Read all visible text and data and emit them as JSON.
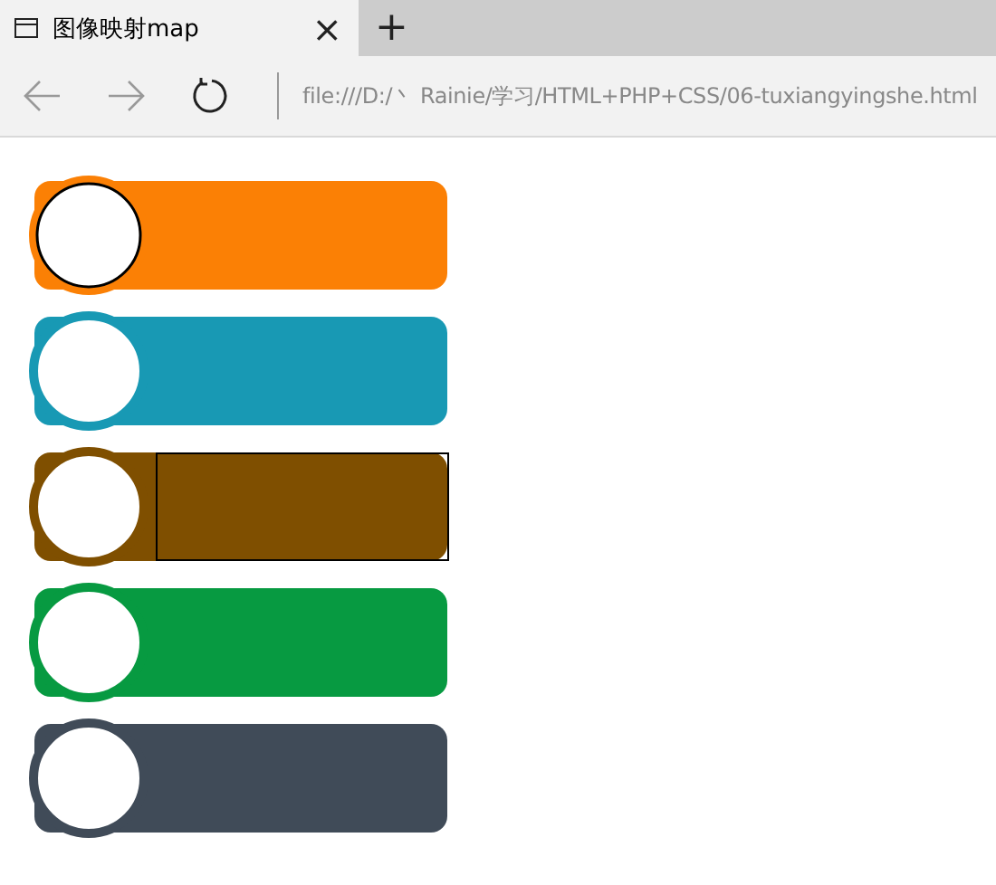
{
  "tab": {
    "title": "图像映射map",
    "close": "×",
    "new_tab": "+"
  },
  "address": {
    "url": "file:///D:/丶 Rainie/学习/HTML+PHP+CSS/06-tuxiangyingshe.html"
  },
  "areas": [
    {
      "color": "#fb8005",
      "circle_focused": true,
      "bar_focused": false
    },
    {
      "color": "#1899b4",
      "circle_focused": false,
      "bar_focused": false
    },
    {
      "color": "#7f4f00",
      "circle_focused": false,
      "bar_focused": true
    },
    {
      "color": "#079a41",
      "circle_focused": false,
      "bar_focused": false
    },
    {
      "color": "#404b58",
      "circle_focused": false,
      "bar_focused": false
    }
  ]
}
